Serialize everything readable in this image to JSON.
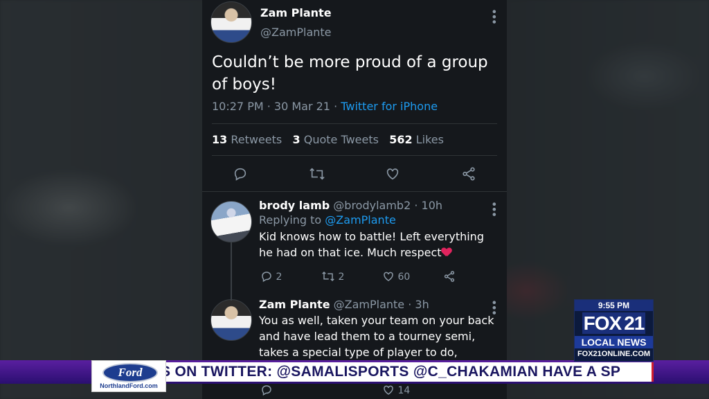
{
  "tweet": {
    "author_name": "Zam Plante",
    "author_handle": "@ZamPlante",
    "text": "Couldn’t be more proud of a group of boys!",
    "timestamp": "10:27 PM · 30 Mar 21 · ",
    "source": "Twitter for iPhone",
    "retweets_count": "13",
    "retweets_label": " Retweets",
    "quotes_count": "3",
    "quotes_label": " Quote Tweets",
    "likes_count": "562",
    "likes_label": " Likes",
    "actions": [
      "reply-icon",
      "retweet-icon",
      "like-icon",
      "share-icon"
    ]
  },
  "replies": [
    {
      "name": "brody lamb",
      "handle": "@brodylamb2 · 10h",
      "replying_prefix": "Replying to ",
      "replying_to": "@ZamPlante",
      "text": "Kid knows how to battle! Left everything he had on that ice. Much respect",
      "reply_count": "2",
      "retweet_count": "2",
      "like_count": "60"
    },
    {
      "name": "Zam Plante",
      "handle": "@ZamPlante · 3h",
      "text": "You as well, taken your team on your back and have lead them to a tourney semi, takes a special type of player to do, nothing but",
      "like_count": "14"
    }
  ],
  "broadcast": {
    "time": "9:55 PM",
    "station": "FOX",
    "channel": "21",
    "local_news": "LOCAL NEWS",
    "site": "FOX21ONLINE.COM",
    "ticker": "S ON TWITTER:  @SAMALISPORTS   @C_CHAKAMIAN          HAVE A SP",
    "sponsor_logo": "Ford",
    "sponsor_site": "NorthlandFord.com"
  }
}
